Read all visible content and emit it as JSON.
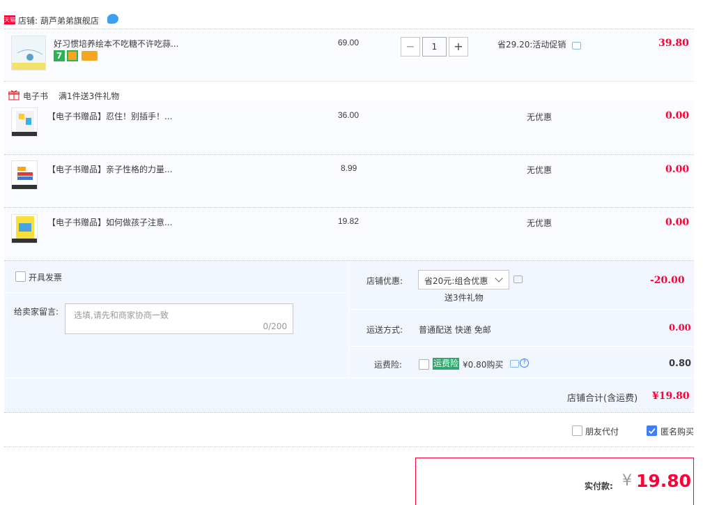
{
  "shop": {
    "badge": "天猫",
    "label": "店铺: 葫芦弟弟旗舰店"
  },
  "main_item": {
    "title": "好习惯培养绘本不吃糖不许吃蒜...",
    "price": "69.00",
    "qty": "1",
    "promo": "省29.20:活动促销",
    "total": "39.80"
  },
  "gift_section": {
    "tag": "电子书",
    "rule": "满1件送3件礼物"
  },
  "gifts": [
    {
      "title": "【电子书赠品】忍住！别插手！...",
      "price": "36.00",
      "promo": "无优惠",
      "total": "0.00"
    },
    {
      "title": "【电子书赠品】亲子性格的力量...",
      "price": "8.99",
      "promo": "无优惠",
      "total": "0.00"
    },
    {
      "title": "【电子书赠品】如何做孩子注意...",
      "price": "19.82",
      "promo": "无优惠",
      "total": "0.00"
    }
  ],
  "invoice": {
    "label": "开具发票"
  },
  "message": {
    "label": "给卖家留言:",
    "placeholder": "选填,请先和商家协商一致",
    "counter": "0/200"
  },
  "discount": {
    "label": "店铺优惠:",
    "selected": "省20元:组合优惠",
    "note": "送3件礼物",
    "amount": "-20.00"
  },
  "shipping": {
    "label": "运送方式:",
    "value": "普通配送 快递 免邮",
    "amount": "0.00"
  },
  "insurance": {
    "label": "运费险:",
    "tag": "运费险",
    "price": "¥0.80购买",
    "amount": "0.80"
  },
  "shop_total": {
    "label": "店铺合计(含运费)",
    "amount": "¥19.80"
  },
  "options": {
    "friend_pay": "朋友代付",
    "anonymous": "匿名购买"
  },
  "pay": {
    "label": "实付款:",
    "currency": "¥",
    "amount": "19.80"
  },
  "colors": {
    "accent_red": "#ff0036",
    "check_blue": "#3d7ef5",
    "insurance_green": "#2fa66b",
    "row_bg": "#fbfcff"
  }
}
